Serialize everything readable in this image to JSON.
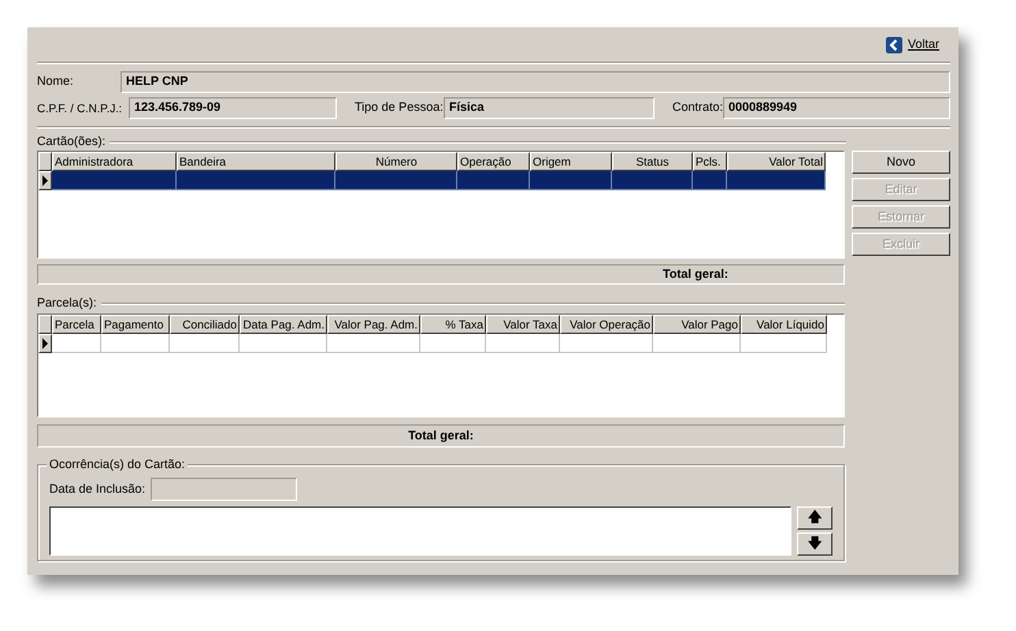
{
  "toolbar": {
    "back_label": "Voltar"
  },
  "person": {
    "name_label": "Nome:",
    "name": "HELP CNP",
    "doc_label": "C.P.F. / C.N.P.J.:",
    "doc": "123.456.789-09",
    "type_label": "Tipo de Pessoa:",
    "type": "Física",
    "contract_label": "Contrato:",
    "contract": "0000889949"
  },
  "cards": {
    "title": "Cartão(ões):",
    "columns": [
      "Administradora",
      "Bandeira",
      "Número",
      "Operação",
      "Origem",
      "Status",
      "Pcls.",
      "Valor Total"
    ],
    "rows": [
      {
        "selected": true
      }
    ],
    "total_label": "Total geral:"
  },
  "card_buttons": [
    {
      "label": "Novo",
      "disabled": false
    },
    {
      "label": "Editar",
      "disabled": true
    },
    {
      "label": "Estornar",
      "disabled": true
    },
    {
      "label": "Excluir",
      "disabled": true
    }
  ],
  "installments": {
    "title": "Parcela(s):",
    "columns": [
      "Parcela",
      "Pagamento",
      "Conciliado",
      "Data Pag. Adm.",
      "Valor Pag. Adm.",
      "% Taxa",
      "Valor Taxa",
      "Valor Operação",
      "Valor Pago",
      "Valor Líquido"
    ],
    "rows": [
      {
        "selected": false
      }
    ],
    "total_label": "Total geral:"
  },
  "occurrences": {
    "title": "Ocorrência(s) do Cartão:",
    "date_label": "Data de Inclusão:",
    "up_label": "🡅",
    "down_label": "🡇"
  }
}
